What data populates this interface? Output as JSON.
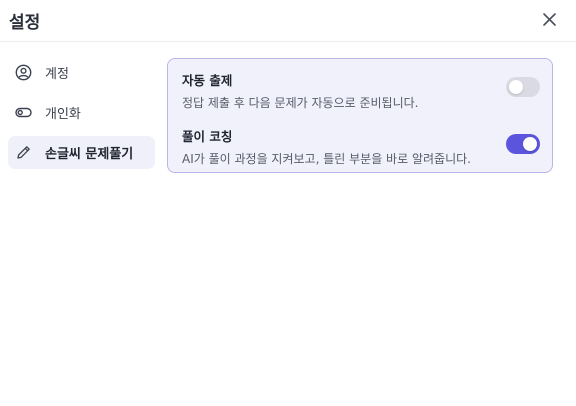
{
  "header": {
    "title": "설정",
    "close_icon": "close-icon"
  },
  "sidebar": {
    "items": [
      {
        "label": "계정",
        "icon": "user-circle-icon",
        "active": false
      },
      {
        "label": "개인화",
        "icon": "toggle-icon",
        "active": false
      },
      {
        "label": "손글씨 문제풀기",
        "icon": "pencil-icon",
        "active": true
      }
    ]
  },
  "settings": [
    {
      "title": "자동 출제",
      "description": "정답 제출 후 다음 문제가 자동으로 준비됩니다.",
      "enabled": false
    },
    {
      "title": "풀이 코칭",
      "description": "AI가 풀이 과정을 지켜보고, 틀린 부분을 바로 알려줍니다.",
      "enabled": true
    }
  ],
  "colors": {
    "accent": "#5b55de",
    "panel_background": "#f1f1fb",
    "panel_border": "#b9b7e8",
    "toggle_off": "#d9dae3",
    "active_nav_background": "#eff0f9"
  }
}
